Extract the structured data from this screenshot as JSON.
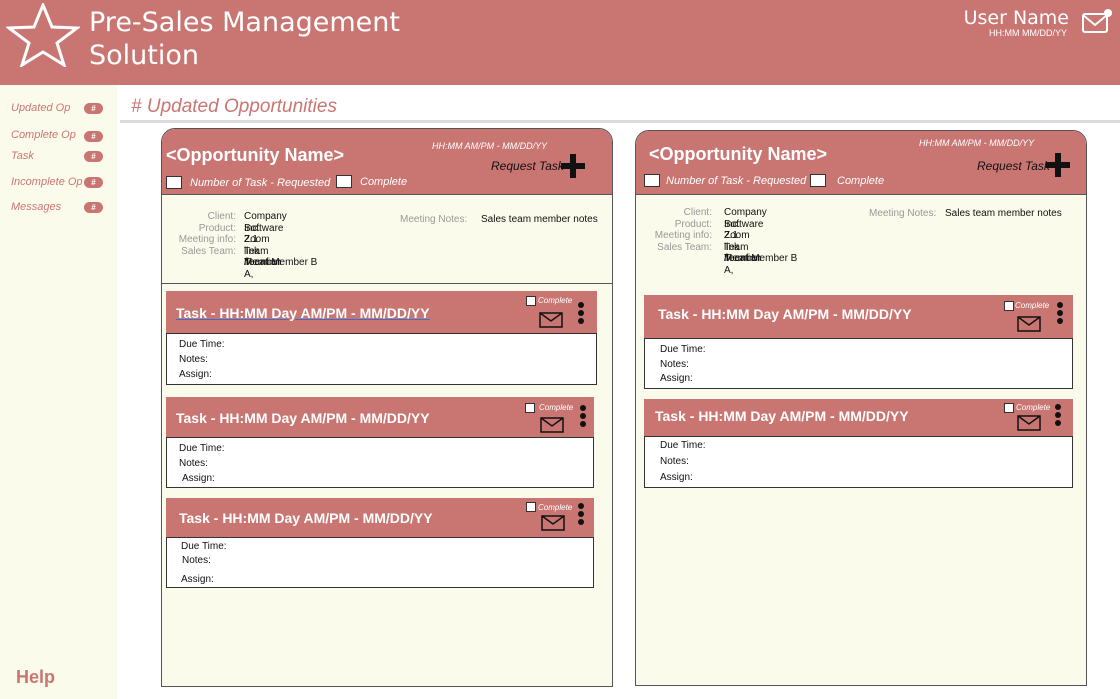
{
  "header": {
    "title_line1": "Pre-Sales Management",
    "title_line2": "Solution",
    "user_name": "User Name",
    "user_time": "HH:MM MM/DD/YY",
    "logo_icon": "star-icon",
    "mail_icon": "mail-notification-icon"
  },
  "sidebar": {
    "items": [
      {
        "label": "Updated Op",
        "badge": "#"
      },
      {
        "label": "Complete Op",
        "badge": "#"
      },
      {
        "label": "Task",
        "badge": "#"
      },
      {
        "label": "Incomplete Op",
        "badge": "#"
      },
      {
        "label": "Messages",
        "badge": "#"
      }
    ],
    "help": "Help"
  },
  "main": {
    "section_title": "# Updated Opportunities"
  },
  "opportunities": [
    {
      "name": "<Opportunity Name>",
      "time": "HH:MM AM/PM - MM/DD/YY",
      "request_task": "Request Task",
      "number_label": "Number of Task - Requested",
      "complete_label": "Complete",
      "info": {
        "client_k": "Client:",
        "client_v": "Company Inc.",
        "product_k": "Product:",
        "product_v": "Software 2.1",
        "meeting_k": "Meeting info:",
        "meeting_v": "Zoom link /location",
        "team_k": "Sales Team:",
        "team_v1": "Team Member A,",
        "team_v2": "Team Member B",
        "notes_k": "Meeting Notes:",
        "notes_v": "Sales team member notes"
      },
      "tasks": [
        {
          "title": "Task - HH:MM Day AM/PM - MM/DD/YY",
          "complete": "Complete",
          "due": "Due Time:",
          "notes": "Notes:",
          "assign": "Assign:"
        },
        {
          "title": "Task - HH:MM Day AM/PM - MM/DD/YY",
          "complete": "Complete",
          "due": "Due Time:",
          "notes": "Notes:",
          "assign": "Assign:"
        },
        {
          "title": "Task - HH:MM Day AM/PM - MM/DD/YY",
          "complete": "Complete",
          "due": "Due Time:",
          "notes": "Notes:",
          "assign": "Assign:"
        }
      ]
    },
    {
      "name": "<Opportunity Name>",
      "time": "HH:MM AM/PM - MM/DD/YY",
      "request_task": "Request Task",
      "number_label": "Number of Task - Requested",
      "complete_label": "Complete",
      "info": {
        "client_k": "Client:",
        "client_v": "Company Inc.",
        "product_k": "Product:",
        "product_v": "Software 2.1",
        "meeting_k": "Meeting info:",
        "meeting_v": "Zoom link /location",
        "team_k": "Sales Team:",
        "team_v1": "Team Member A,",
        "team_v2": "Team Member B",
        "notes_k": "Meeting Notes:",
        "notes_v": "Sales team member notes"
      },
      "tasks": [
        {
          "title": "Task - HH:MM Day AM/PM - MM/DD/YY",
          "complete": "Complete",
          "due": "Due Time:",
          "notes": "Notes:",
          "assign": "Assign:"
        },
        {
          "title": "Task - HH:MM Day AM/PM - MM/DD/YY",
          "complete": "Complete",
          "due": "Due Time:",
          "notes": "Notes:",
          "assign": "Assign:"
        }
      ]
    }
  ],
  "colors": {
    "brand": "#c97673",
    "sidebar_bg": "#fbfbeb",
    "card_bg": "#fbfbeb"
  }
}
